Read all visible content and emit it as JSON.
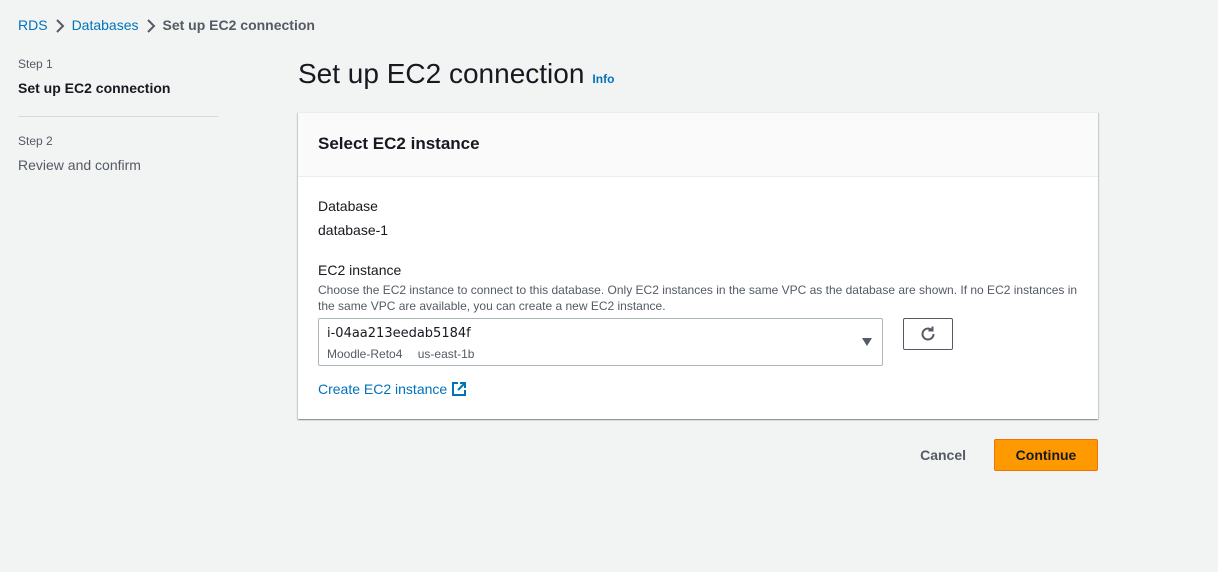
{
  "breadcrumb": {
    "items": [
      "RDS",
      "Databases"
    ],
    "current": "Set up EC2 connection"
  },
  "steps": [
    {
      "number": "Step 1",
      "label": "Set up EC2 connection",
      "active": true
    },
    {
      "number": "Step 2",
      "label": "Review and confirm",
      "active": false
    }
  ],
  "page": {
    "title": "Set up EC2 connection",
    "info": "Info"
  },
  "panel": {
    "title": "Select EC2 instance",
    "database_label": "Database",
    "database_value": "database-1",
    "ec2_label": "EC2 instance",
    "ec2_description": "Choose the EC2 instance to connect to this database. Only EC2 instances in the same VPC as the database are shown. If no EC2 instances in the same VPC are available, you can create a new EC2 instance.",
    "selected_instance_id": "i-04aa213eedab5184f",
    "selected_instance_name": "Moodle-Reto4",
    "selected_instance_az": "us-east-1b",
    "create_link": "Create EC2 instance"
  },
  "actions": {
    "cancel": "Cancel",
    "continue": "Continue"
  },
  "colors": {
    "link": "#0073bb",
    "primary_button": "#ff9900",
    "background": "#f2f3f3"
  }
}
